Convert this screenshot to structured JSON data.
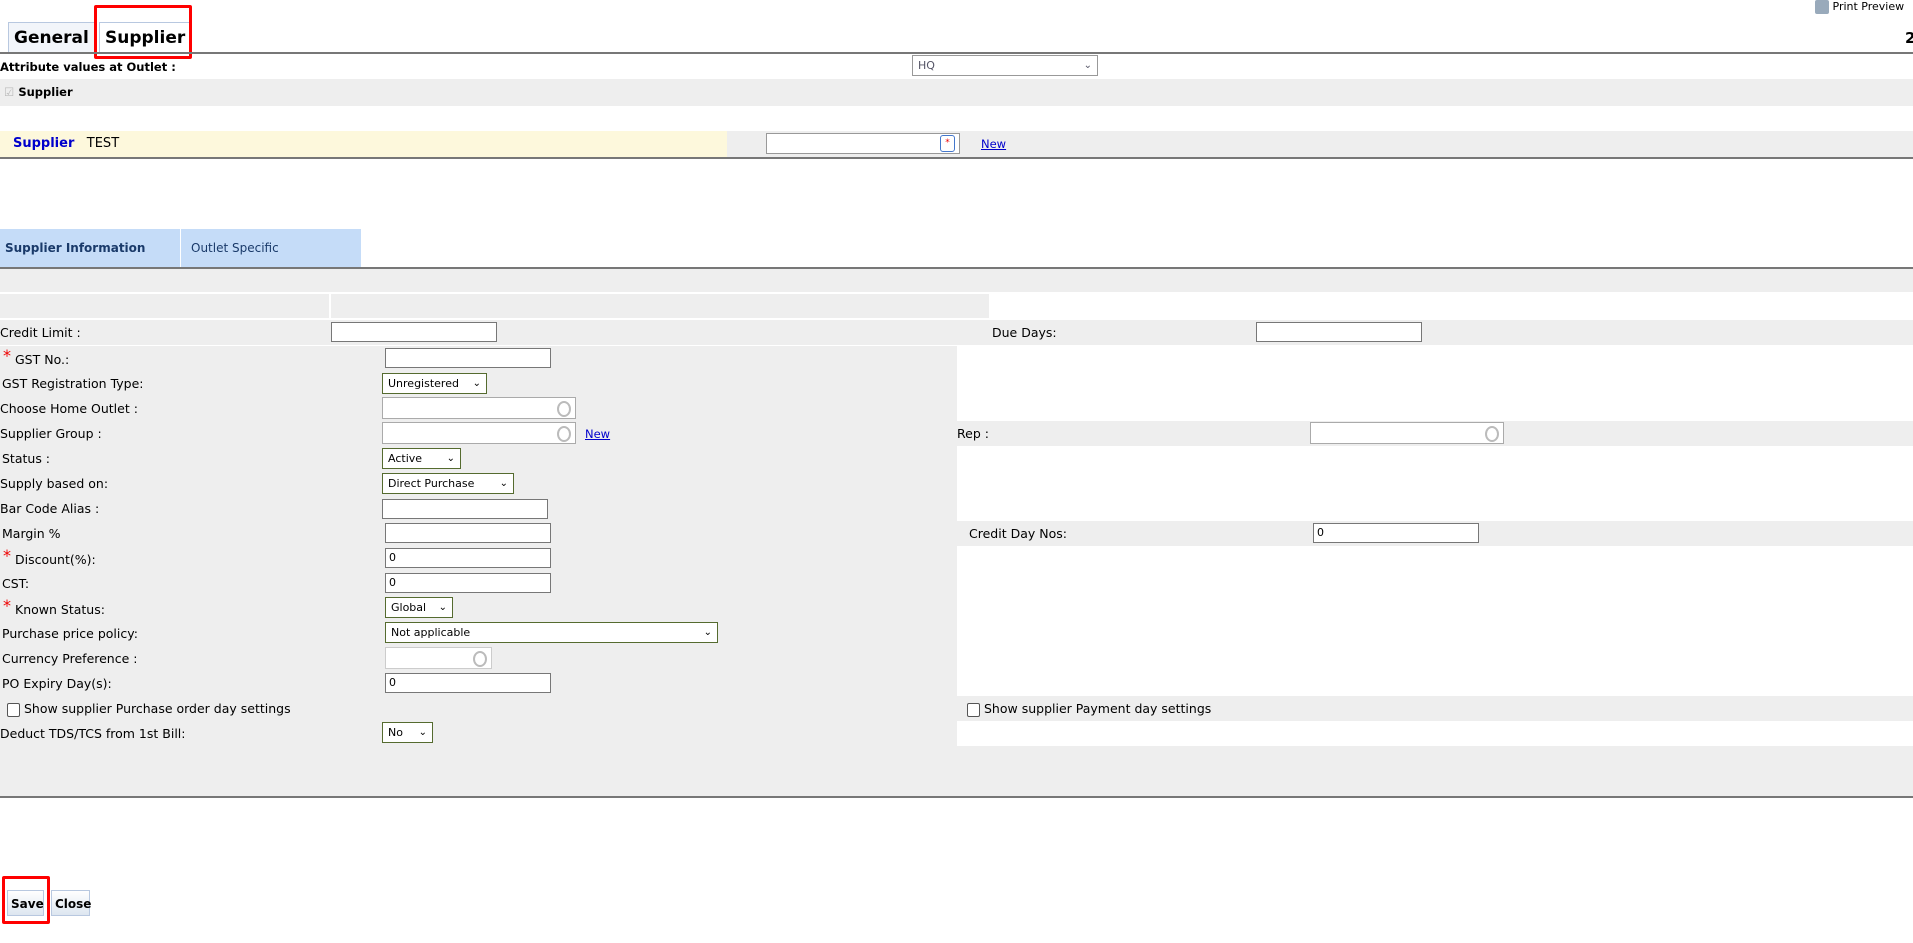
{
  "tabs": {
    "general": "General",
    "supplier": "Supplier"
  },
  "print_preview": "Print Preview",
  "page_number": "2",
  "attribute_label": "Attribute values at Outlet :",
  "outlet_select": "HQ",
  "supplier_checkbox": "Supplier",
  "supplier_header": {
    "label": "Supplier",
    "value": "TEST",
    "new_link": "New"
  },
  "subtabs": {
    "info": "Supplier Information",
    "outlet": "Outlet Specific"
  },
  "form": {
    "credit_limit": "Credit Limit :",
    "due_days": "Due Days:",
    "gst_no": "GST No.:",
    "gst_reg_type": "GST Registration Type:",
    "gst_reg_value": "Unregistered",
    "home_outlet": "Choose Home Outlet :",
    "supplier_group": "Supplier Group :",
    "group_new": "New",
    "rep": "Rep :",
    "status": "Status :",
    "status_value": "Active",
    "supply_based": "Supply based on:",
    "supply_value": "Direct Purchase",
    "bar_code": "Bar Code Alias :",
    "margin": "Margin %",
    "credit_day_nos": "Credit Day Nos:",
    "credit_day_value": "0",
    "discount": "Discount(%):",
    "discount_value": "0",
    "cst": "CST:",
    "cst_value": "0",
    "known_status": "Known Status:",
    "known_value": "Global",
    "purchase_policy": "Purchase price policy:",
    "purchase_value": "Not applicable",
    "currency": "Currency Preference :",
    "po_expiry": "PO Expiry Day(s):",
    "po_value": "0",
    "show_po_settings": "Show supplier Purchase order day settings",
    "show_payment_settings": "Show supplier Payment day settings",
    "deduct_tds": "Deduct TDS/TCS from 1st Bill:",
    "deduct_value": "No"
  },
  "buttons": {
    "save": "Save",
    "close": "Close"
  }
}
